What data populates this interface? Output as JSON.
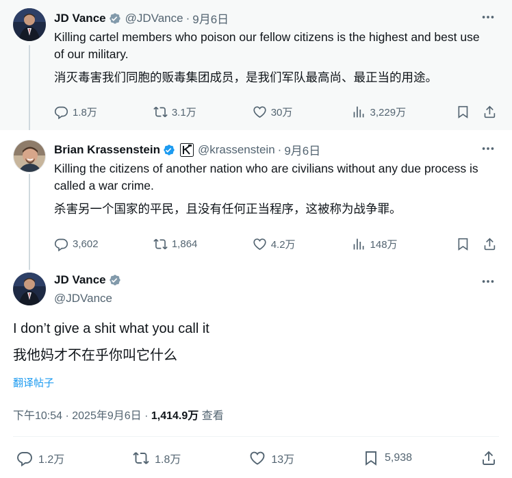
{
  "tweets": [
    {
      "name": "JD Vance",
      "handle": "@JDVance",
      "separator": "·",
      "date": "9月6日",
      "text_en": "Killing cartel members who poison our fellow citizens is the highest and best use of our military.",
      "text_zh": "消灭毒害我们同胞的贩毒集团成员，是我们军队最高尚、最正当的用途。",
      "replies": "1.8万",
      "reposts": "3.1万",
      "likes": "30万",
      "views": "3,229万"
    },
    {
      "name": "Brian Krassenstein",
      "handle": "@krassenstein",
      "separator": "·",
      "date": "9月6日",
      "text_en": "Killing the citizens of another nation who are civilians without any due process is called a war crime.",
      "text_zh": "杀害另一个国家的平民，且没有任何正当程序，这被称为战争罪。",
      "replies": "3,602",
      "reposts": "1,864",
      "likes": "4.2万",
      "views": "148万"
    }
  ],
  "main": {
    "name": "JD Vance",
    "handle": "@JDVance",
    "text_en": "I don’t give a shit what you call it",
    "text_zh": "我他妈才不在乎你叫它什么",
    "translate_label": "翻译帖子",
    "time": "下午10:54 · 2025年9月6日 · ",
    "views_count": "1,414.9万",
    "views_label": " 查看",
    "replies": "1.2万",
    "reposts": "1.8万",
    "likes": "13万",
    "bookmarks": "5,938"
  },
  "colors": {
    "accent": "#1d9bf0",
    "secondary_text": "#536471",
    "verified_gray": "#829aab",
    "verified_blue": "#1d9bf0",
    "highlight_bg": "#f7f9f9"
  }
}
